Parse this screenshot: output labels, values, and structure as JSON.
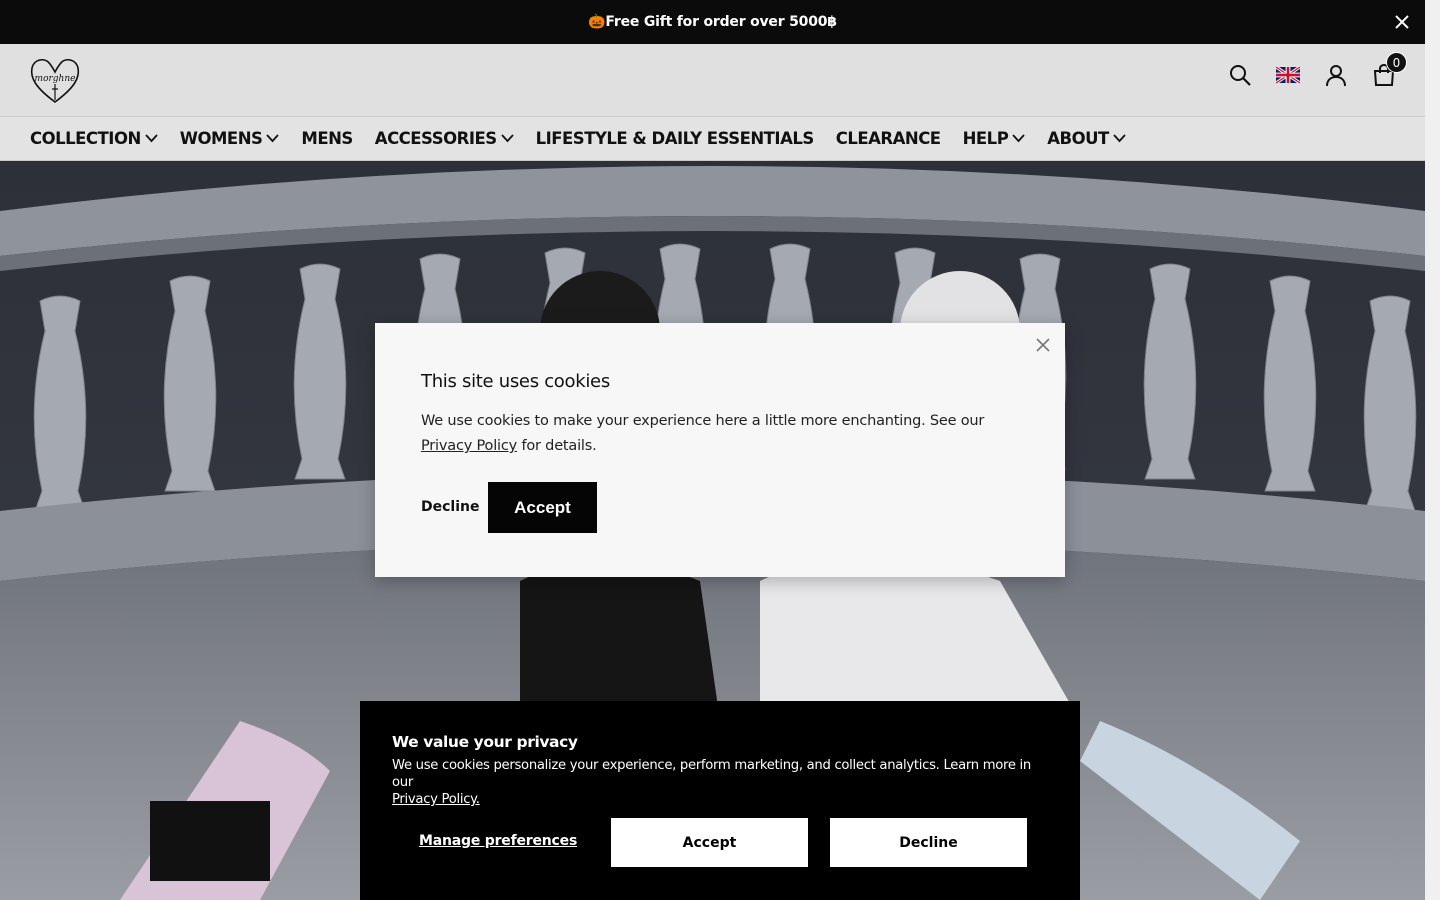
{
  "announcement": {
    "text": "🎃Free Gift for order over 5000฿",
    "close_icon": "close-icon"
  },
  "header": {
    "logo_alt": "morgh-sne-logo",
    "icons": [
      "search-icon",
      "flag-uk-icon",
      "user-icon",
      "cart-icon"
    ],
    "cart_count": "0"
  },
  "nav": {
    "items": [
      {
        "label": "COLLECTION",
        "dropdown": true
      },
      {
        "label": "WOMENS",
        "dropdown": true
      },
      {
        "label": "MENS",
        "dropdown": false
      },
      {
        "label": "ACCESSORIES",
        "dropdown": true
      },
      {
        "label": "LIFESTYLE & DAILY ESSENTIALS",
        "dropdown": false
      },
      {
        "label": "CLEARANCE",
        "dropdown": false
      },
      {
        "label": "HELP",
        "dropdown": true
      },
      {
        "label": "ABOUT",
        "dropdown": true
      }
    ]
  },
  "cookie_modal": {
    "title": "This site uses cookies",
    "body_prefix": "We use cookies to make your experience here a little more enchanting. See our ",
    "link": "Privacy Policy",
    "body_suffix": " for details.",
    "decline": "Decline",
    "accept": "Accept"
  },
  "privacy_banner": {
    "title": "We value your privacy",
    "desc": "We use cookies personalize your experience, perform marketing, and collect analytics. Learn more in our ",
    "link": "Privacy Policy.",
    "manage": "Manage preferences",
    "accept": "Accept",
    "decline": "Decline"
  },
  "colors": {
    "announce_bg": "#0b0b0b",
    "header_bg": "#e0e0e0",
    "button_dark": "#050505",
    "banner_bg": "#000000"
  }
}
